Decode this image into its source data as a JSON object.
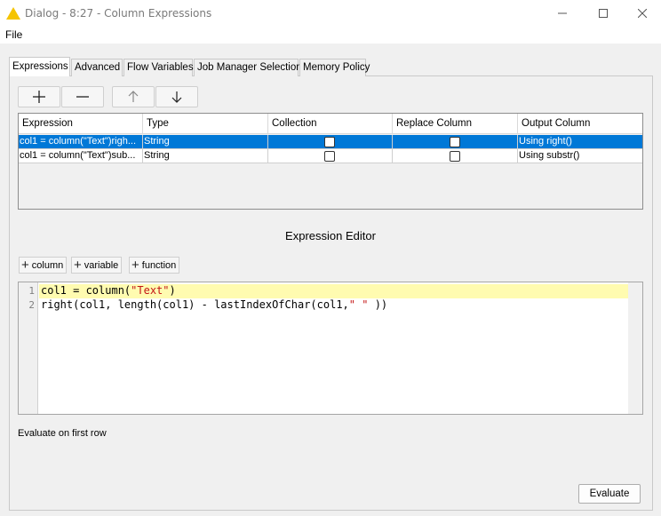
{
  "window": {
    "title": "Dialog - 8:27 - Column Expressions",
    "minimize_icon": "minimize-icon",
    "maximize_icon": "maximize-icon",
    "close_icon": "close-icon"
  },
  "menu": {
    "file": "File"
  },
  "tabs": [
    {
      "label": "Expressions",
      "active": true
    },
    {
      "label": "Advanced"
    },
    {
      "label": "Flow Variables"
    },
    {
      "label": "Job Manager Selection"
    },
    {
      "label": "Memory Policy"
    }
  ],
  "toolbar": {
    "add_icon": "plus-icon",
    "remove_icon": "minus-icon",
    "up_icon": "arrow-up-icon",
    "down_icon": "arrow-down-icon"
  },
  "table": {
    "headers": [
      "Expression",
      "Type",
      "Collection",
      "Replace Column",
      "Output Column"
    ],
    "rows": [
      {
        "expression": "col1 = column(\"Text\")righ...",
        "type": "String",
        "collection": false,
        "replace": false,
        "output": "Using right()",
        "selected": true
      },
      {
        "expression": "col1 = column(\"Text\")sub...",
        "type": "String",
        "collection": false,
        "replace": false,
        "output": "Using substr()",
        "selected": false
      }
    ]
  },
  "editor": {
    "title": "Expression Editor",
    "buttons": {
      "column": "column",
      "variable": "variable",
      "function": "function"
    },
    "line_numbers": [
      "1",
      "2"
    ],
    "lines": [
      {
        "pre": "col1 = column(",
        "str": "\"Text\"",
        "post": ")"
      },
      {
        "pre": "right(col1, length(col1) - lastIndexOfChar(col1,",
        "str": "\" \"",
        "post": " ))"
      }
    ]
  },
  "evaluate_label": "Evaluate on first row",
  "evaluate_button": "Evaluate",
  "colors": {
    "selection": "#0078d7",
    "line_highlight": "#fffbb0",
    "string": "#c41616",
    "warning_icon": "#f5c400"
  }
}
